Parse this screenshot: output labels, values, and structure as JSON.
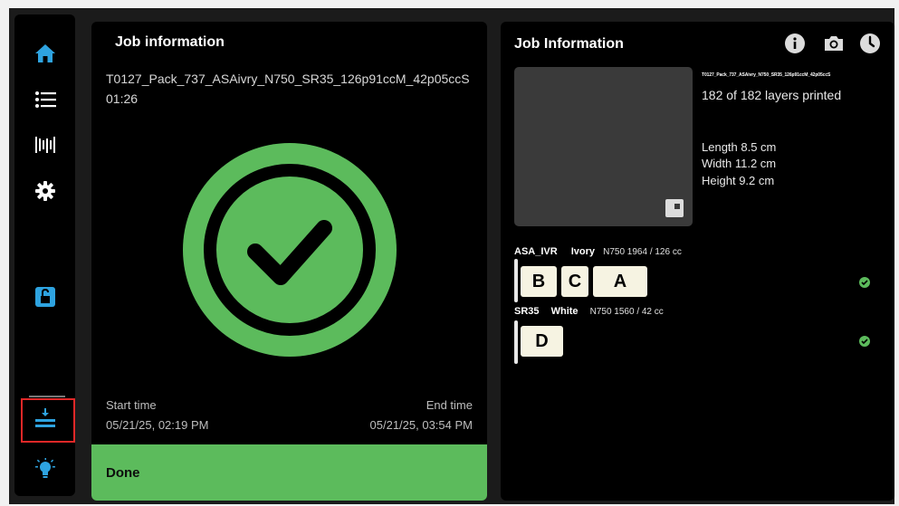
{
  "colors": {
    "accent_blue": "#2ea3e0",
    "success_green": "#5cbb5c",
    "highlight_red": "#e02828"
  },
  "sidebar": {
    "items": [
      {
        "icon": "home-icon"
      },
      {
        "icon": "list-icon"
      },
      {
        "icon": "material-cartridge-icon"
      },
      {
        "icon": "gear-icon"
      },
      {
        "icon": "unlock-icon"
      },
      {
        "icon": "download-tray-icon"
      },
      {
        "icon": "lightbulb-icon"
      }
    ]
  },
  "left_panel": {
    "title": "Job information",
    "job_name": "T0127_Pack_737_ASAivry_N750_SR35_126p91ccM_42p05ccS",
    "duration": "01:26",
    "start_label": "Start time",
    "start_value": "05/21/25, 02:19 PM",
    "end_label": "End time",
    "end_value": "05/21/25, 03:54 PM",
    "done_label": "Done"
  },
  "right_panel": {
    "title": "Job Information",
    "header_icons": [
      "info-icon",
      "camera-icon",
      "clock-icon"
    ],
    "job_name_small": "T0127_Pack_737_ASAivry_N750_SR35_126p91ccM_42p05ccS",
    "layers": "182 of 182 layers printed",
    "length": "Length 8.5 cm",
    "width": "Width 11.2 cm",
    "height": "Height 9.2 cm",
    "materials": [
      {
        "name": "ASA_IVR",
        "color": "Ivory",
        "qty": "N750 1964 / 126 cc",
        "slots": [
          "B",
          "C",
          "A"
        ]
      },
      {
        "name": "SR35",
        "color": "White",
        "qty": "N750 1560 / 42 cc",
        "slots": [
          "D"
        ]
      }
    ]
  }
}
